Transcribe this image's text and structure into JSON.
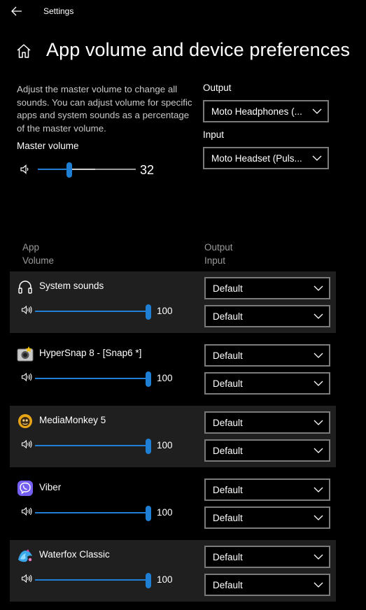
{
  "window": {
    "title": "Settings"
  },
  "page": {
    "title": "App volume and device preferences",
    "description": "Adjust the master volume to change all sounds. You can adjust volume for specific apps and system sounds as a percentage of the master volume."
  },
  "master": {
    "label": "Master volume",
    "value": "32",
    "level": 32
  },
  "output": {
    "label": "Output",
    "selected": "Moto Headphones (..."
  },
  "input": {
    "label": "Input",
    "selected": "Moto Headset (Puls..."
  },
  "columns": {
    "left_top": "App",
    "left_bottom": "Volume",
    "right_top": "Output",
    "right_bottom": "Input"
  },
  "apps": [
    {
      "name": "System sounds",
      "icon": "headphones-icon",
      "volume": "100",
      "level": 100,
      "output": "Default",
      "input": "Default"
    },
    {
      "name": "HyperSnap 8 - [Snap6 *]",
      "icon": "hypersnap-icon",
      "volume": "100",
      "level": 100,
      "output": "Default",
      "input": "Default"
    },
    {
      "name": "MediaMonkey 5",
      "icon": "mediamonkey-icon",
      "volume": "100",
      "level": 100,
      "output": "Default",
      "input": "Default"
    },
    {
      "name": "Viber",
      "icon": "viber-icon",
      "volume": "100",
      "level": 100,
      "output": "Default",
      "input": "Default"
    },
    {
      "name": "Waterfox Classic",
      "icon": "waterfox-icon",
      "volume": "100",
      "level": 100,
      "output": "Default",
      "input": "Default"
    }
  ],
  "colors": {
    "accent": "#1f7fd4",
    "row_shade": "#1f1f1f",
    "background": "#000000"
  }
}
